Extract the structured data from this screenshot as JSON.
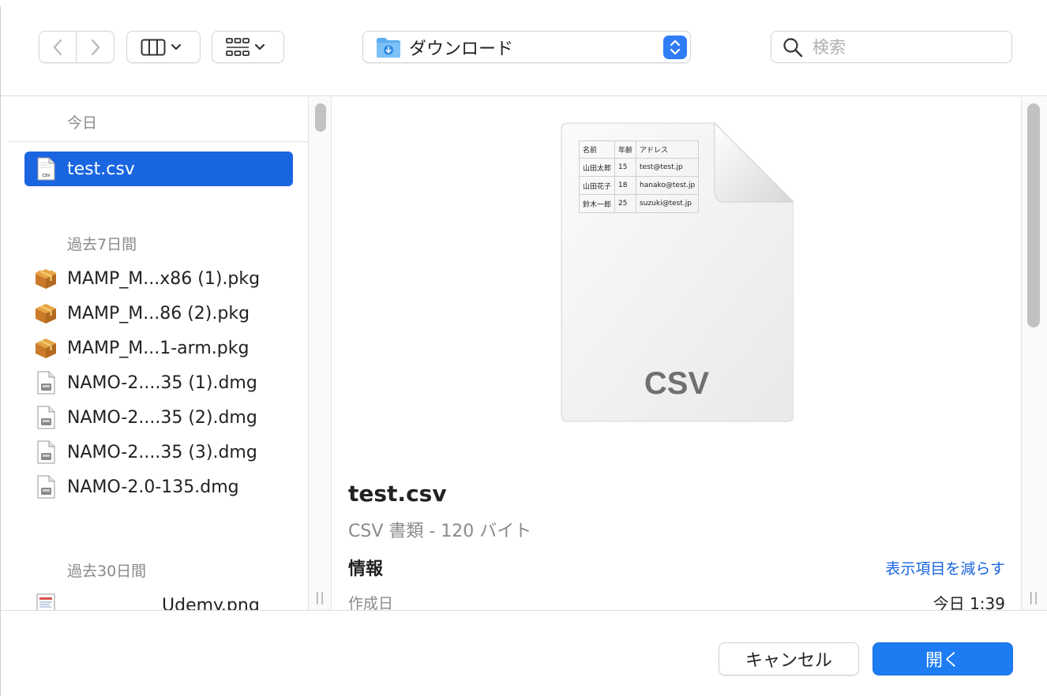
{
  "toolbar": {
    "location_label": "ダウンロード",
    "search_placeholder": "検索"
  },
  "sidebar": {
    "sections": [
      {
        "title": "今日"
      },
      {
        "title": "過去7日間"
      },
      {
        "title": "過去30日間"
      }
    ],
    "today_items": [
      {
        "name": "test.csv",
        "icon": "csv-file-icon",
        "selected": true
      }
    ],
    "week_items": [
      {
        "name": "MAMP_M...x86 (1).pkg",
        "icon": "package-icon"
      },
      {
        "name": "MAMP_M...86 (2).pkg",
        "icon": "package-icon"
      },
      {
        "name": "MAMP_M...1-arm.pkg",
        "icon": "package-icon"
      },
      {
        "name": "NAMO-2....35 (1).dmg",
        "icon": "disk-image-icon"
      },
      {
        "name": "NAMO-2....35 (2).dmg",
        "icon": "disk-image-icon"
      },
      {
        "name": "NAMO-2....35 (3).dmg",
        "icon": "disk-image-icon"
      },
      {
        "name": "NAMO-2.0-135.dmg",
        "icon": "disk-image-icon"
      }
    ],
    "month_items": [
      {
        "name": "Udemy.png",
        "icon": "image-file-icon"
      }
    ]
  },
  "preview": {
    "thumbnail_table": [
      [
        "名前",
        "年齢",
        "アドレス"
      ],
      [
        "山田太郎",
        "15",
        "test@test.jp"
      ],
      [
        "山田花子",
        "18",
        "hanako@test.jp"
      ],
      [
        "鈴木一郎",
        "25",
        "suzuki@test.jp"
      ]
    ],
    "thumbnail_ext": "CSV",
    "file_name": "test.csv",
    "file_meta": "CSV 書類 - 120 バイト",
    "info_title": "情報",
    "info_toggle": "表示項目を減らす",
    "info_rows": [
      {
        "key": "作成日",
        "value": "今日 1:39"
      }
    ]
  },
  "footer": {
    "cancel_label": "キャンセル",
    "open_label": "開く"
  },
  "colors": {
    "accent": "#1d7cf2",
    "selection": "#1a65e0"
  }
}
